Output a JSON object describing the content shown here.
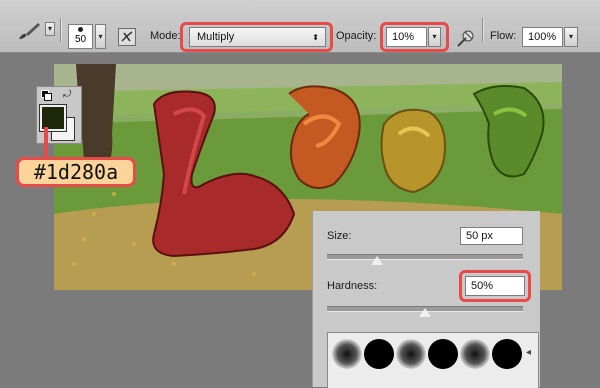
{
  "toolbar": {
    "brush_size": "50",
    "mode_label": "Mode:",
    "mode_value": "Multiply",
    "opacity_label": "Opacity:",
    "opacity_value": "10%",
    "flow_label": "Flow:",
    "flow_value": "100%"
  },
  "foreground_color": {
    "hex": "#1d280a",
    "label": "#1d280a"
  },
  "brush_panel": {
    "size_label": "Size:",
    "size_value": "50 px",
    "size_level": 0.2,
    "hardness_label": "Hardness:",
    "hardness_value": "50%",
    "hardness_level": 0.5
  },
  "colors": {
    "highlight": "#e84a4a",
    "callout_bg": "#fbd49a"
  },
  "icons": [
    "brush-icon",
    "brush-panel-toggle-icon",
    "airbrush-icon",
    "swap-colors-icon",
    "default-colors-icon"
  ]
}
